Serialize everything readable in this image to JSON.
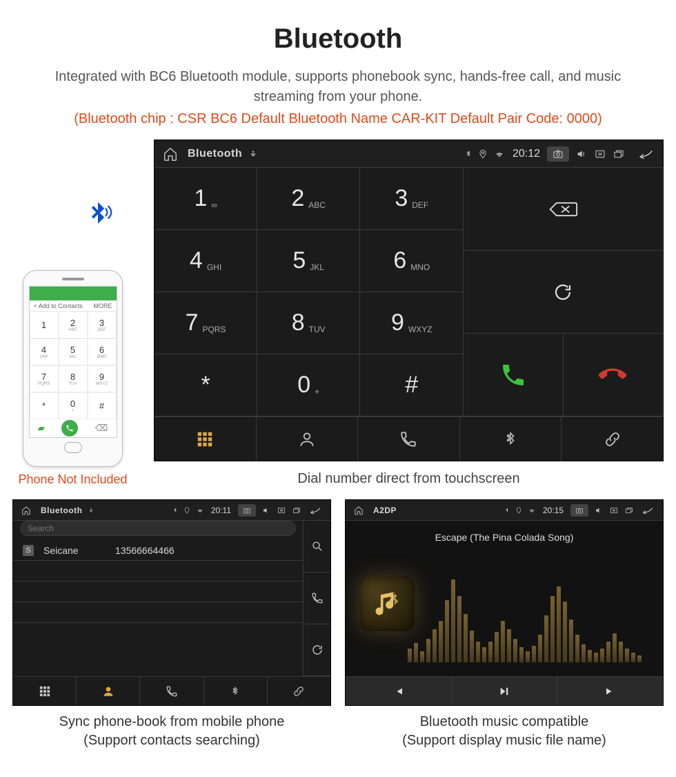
{
  "hero": {
    "title": "Bluetooth",
    "subtitle": "Integrated with BC6 Bluetooth module, supports phonebook sync, hands-free call, and music streaming from your phone.",
    "spec": "(Bluetooth chip : CSR BC6    Default Bluetooth Name CAR-KIT    Default Pair Code: 0000)"
  },
  "phone_caption": "Phone Not Included",
  "dialer_caption": "Dial number direct from touchscreen",
  "phonebook_caption_l1": "Sync phone-book from mobile phone",
  "phonebook_caption_l2": "(Support contacts searching)",
  "music_caption_l1": "Bluetooth music compatible",
  "music_caption_l2": "(Support display music file name)",
  "status": {
    "title_bt": "Bluetooth",
    "title_a2dp": "A2DP",
    "time_main": "20:12",
    "time_pb": "20:11",
    "time_music": "20:15"
  },
  "keys": [
    {
      "d": "1",
      "s": "∞"
    },
    {
      "d": "2",
      "s": "ABC"
    },
    {
      "d": "3",
      "s": "DEF"
    },
    {
      "d": "4",
      "s": "GHI"
    },
    {
      "d": "5",
      "s": "JKL"
    },
    {
      "d": "6",
      "s": "MNO"
    },
    {
      "d": "7",
      "s": "PQRS"
    },
    {
      "d": "8",
      "s": "TUV"
    },
    {
      "d": "9",
      "s": "WXYZ"
    },
    {
      "d": "*",
      "s": ""
    },
    {
      "d": "0",
      "s": "+"
    },
    {
      "d": "#",
      "s": ""
    }
  ],
  "mock_keys": [
    {
      "d": "1",
      "s": ""
    },
    {
      "d": "2",
      "s": "ABC"
    },
    {
      "d": "3",
      "s": "DEF"
    },
    {
      "d": "4",
      "s": "GHI"
    },
    {
      "d": "5",
      "s": "JKL"
    },
    {
      "d": "6",
      "s": "MNO"
    },
    {
      "d": "7",
      "s": "PQRS"
    },
    {
      "d": "8",
      "s": "TUV"
    },
    {
      "d": "9",
      "s": "WXYZ"
    },
    {
      "d": "*",
      "s": ""
    },
    {
      "d": "0",
      "s": "+"
    },
    {
      "d": "#",
      "s": ""
    }
  ],
  "mock_top": "",
  "mock_title_left": "+  Add to Contacts",
  "mock_title_right": "MORE",
  "phonebook": {
    "search_ph": "Search",
    "contact_badge": "S",
    "contact_name": "Seicane",
    "contact_number": "13566664466"
  },
  "music": {
    "song": "Escape (The Pina Colada Song)"
  }
}
